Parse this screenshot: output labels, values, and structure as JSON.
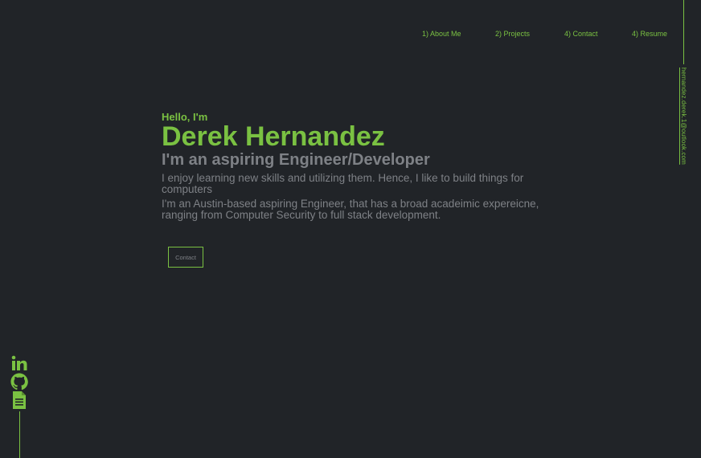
{
  "nav": {
    "items": [
      {
        "label": "1) About Me"
      },
      {
        "label": "2) Projects"
      },
      {
        "label": "4) Contact"
      },
      {
        "label": "4) Resume"
      }
    ]
  },
  "email": "hernandez.derek.1@outlook.com",
  "hero": {
    "greeting": "Hello, I'm",
    "name": "Derek Hernandez",
    "role": "I'm an aspiring Engineer/Developer",
    "description": "I enjoy learning new skills and utilizing them. Hence, I like to build things for computers",
    "bio_line1": "I'm an Austin-based aspiring Engineer, that has a broad acadeimic expereicne,",
    "bio_line2": "ranging from Computer Security to full stack development.",
    "contact_label": "Contact"
  },
  "socials": {
    "icons": [
      "linkedin-icon",
      "github-icon",
      "document-icon"
    ]
  },
  "colors": {
    "background": "#212428",
    "accent": "#7ac142",
    "muted_text": "#7e8186"
  }
}
